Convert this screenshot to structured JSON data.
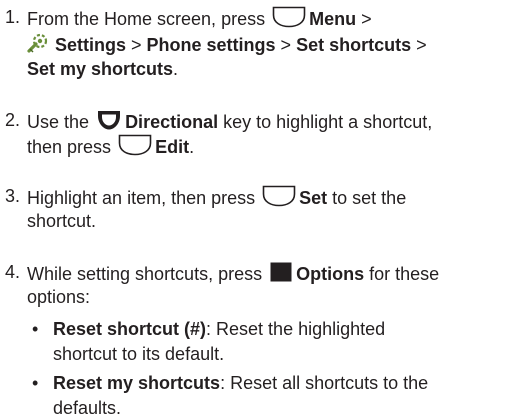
{
  "steps": [
    {
      "number": "1.",
      "lines": [
        {
          "t1": "From the Home screen, press",
          "b1": "Menu",
          "t2": " >"
        },
        {
          "b1": "Settings",
          "t1": " > ",
          "b2": "Phone settings",
          "t2": " > ",
          "b3": "Set shortcuts",
          "t3": " >"
        },
        {
          "b1": "Set my shortcuts",
          "t1": "."
        }
      ]
    },
    {
      "number": "2.",
      "lines": [
        {
          "t1": "Use the",
          "b1": "Directional",
          "t2": " key to highlight a shortcut,"
        },
        {
          "t1": "then press",
          "b1": "Edit",
          "t2": "."
        }
      ]
    },
    {
      "number": "3.",
      "lines": [
        {
          "t1": "Highlight an item, then press",
          "b1": "Set",
          "t2": " to set the"
        },
        {
          "t1": "shortcut."
        }
      ]
    },
    {
      "number": "4.",
      "lines": [
        {
          "t1": "While setting shortcuts, press",
          "b1": "Options",
          "t2": " for these"
        },
        {
          "t1": "options:"
        }
      ]
    }
  ],
  "bullets": [
    {
      "glyph": "•",
      "lines": [
        {
          "b1": "Reset shortcut (#)",
          "t1": ": Reset the highlighted"
        },
        {
          "t1": "shortcut to its default."
        }
      ]
    },
    {
      "glyph": "•",
      "lines": [
        {
          "b1": "Reset my shortcuts",
          "t1": ": Reset all shortcuts to the"
        },
        {
          "t1": "defaults."
        }
      ]
    }
  ],
  "icons": {
    "softkey": "softkey-icon",
    "settings": "settings-wrench-icon",
    "directional": "directional-key-icon",
    "options": "options-key-icon"
  },
  "colors": {
    "text": "#231f20",
    "key_outline": "#231f20",
    "key_fill": "#ffffff",
    "settings_icon": "#6a8f3a"
  }
}
